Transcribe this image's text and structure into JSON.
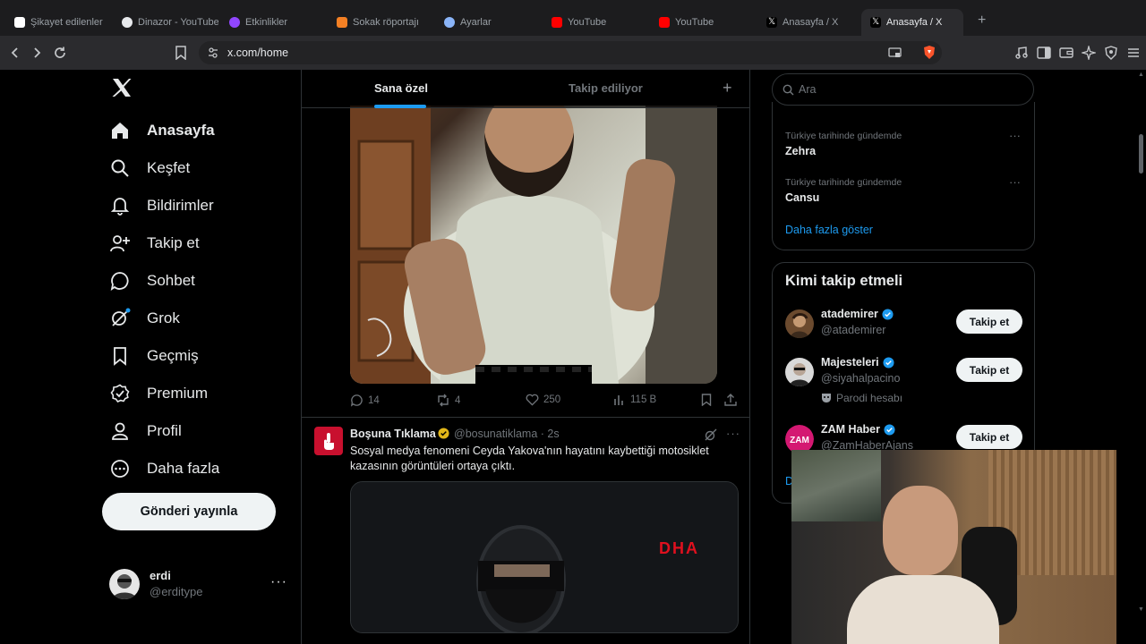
{
  "browser": {
    "tabs": [
      {
        "title": "Şikayet edilenler",
        "color": "#ffffff"
      },
      {
        "title": "Dinazor - YouTube",
        "color": "#e8eaed"
      },
      {
        "title": "Etkinlikler",
        "color": "#9146ff"
      },
      {
        "title": "Sokak röportajı",
        "color": "#f48024"
      },
      {
        "title": "Ayarlar",
        "color": "#8ab4f8"
      },
      {
        "title": "YouTube",
        "color": "#ff0000"
      },
      {
        "title": "YouTube",
        "color": "#ff0000"
      },
      {
        "title": "Anasayfa / X",
        "color": "#ffffff"
      },
      {
        "title": "Anasayfa / X",
        "color": "#ffffff"
      }
    ],
    "url": "x.com/home"
  },
  "nav": {
    "items": [
      {
        "label": "Anasayfa",
        "icon": "home-icon"
      },
      {
        "label": "Keşfet",
        "icon": "search-icon"
      },
      {
        "label": "Bildirimler",
        "icon": "bell-icon"
      },
      {
        "label": "Takip et",
        "icon": "follow-icon"
      },
      {
        "label": "Sohbet",
        "icon": "chat-icon"
      },
      {
        "label": "Grok",
        "icon": "grok-icon"
      },
      {
        "label": "Geçmiş",
        "icon": "bookmark-icon"
      },
      {
        "label": "Premium",
        "icon": "verified-icon"
      },
      {
        "label": "Profil",
        "icon": "profile-icon"
      },
      {
        "label": "Daha fazla",
        "icon": "more-circle-icon"
      }
    ],
    "post_button": "Gönderi yayınla",
    "account": {
      "name": "erdi",
      "handle": "@erditype"
    }
  },
  "feed": {
    "tabs": [
      "Sana özel",
      "Takip ediliyor"
    ],
    "tweet1_actions": {
      "replies": "14",
      "reposts": "4",
      "likes": "250",
      "views": "115 B"
    },
    "tweet2": {
      "name": "Boşuna Tıklama",
      "handle": "@bosunatiklama · 2s",
      "text": "Sosyal medya fenomeni Ceyda Yakova'nın hayatını kaybettiği motosiklet kazasının görüntüleri ortaya çıktı.",
      "watermark": "DHA"
    }
  },
  "sidebar": {
    "search_placeholder": "Ara",
    "trends": [
      {
        "meta": "Türkiye tarihinde gündemde",
        "topic": "Zehra"
      },
      {
        "meta": "Türkiye tarihinde gündemde",
        "topic": "Cansu"
      }
    ],
    "show_more": "Daha fazla göster",
    "who_to_follow": {
      "title": "Kimi takip etmeli",
      "accounts": [
        {
          "name": "atademirer",
          "handle": "@atademirer",
          "sub": ""
        },
        {
          "name": "Majesteleri",
          "handle": "@siyahalpacino",
          "sub": "Parodi hesabı"
        },
        {
          "name": "ZAM Haber",
          "handle": "@ZamHaberAjans",
          "sub": ""
        }
      ],
      "follow_label": "Takip et",
      "more": "D"
    }
  }
}
